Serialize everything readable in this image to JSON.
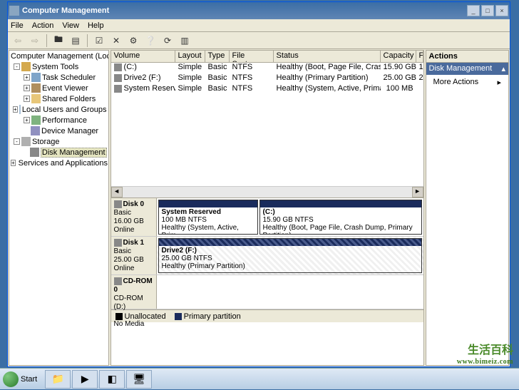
{
  "window": {
    "title": "Computer Management"
  },
  "menu": {
    "file": "File",
    "action": "Action",
    "view": "View",
    "help": "Help"
  },
  "tree": {
    "root": "Computer Management (Local)",
    "system_tools": "System Tools",
    "task_scheduler": "Task Scheduler",
    "event_viewer": "Event Viewer",
    "shared_folders": "Shared Folders",
    "local_users": "Local Users and Groups",
    "performance": "Performance",
    "device_manager": "Device Manager",
    "storage": "Storage",
    "disk_management": "Disk Management",
    "services": "Services and Applications"
  },
  "vol_headers": {
    "volume": "Volume",
    "layout": "Layout",
    "type": "Type",
    "fs": "File System",
    "status": "Status",
    "capacity": "Capacity",
    "f": "F"
  },
  "volumes": [
    {
      "name": "(C:)",
      "layout": "Simple",
      "type": "Basic",
      "fs": "NTFS",
      "status": "Healthy (Boot, Page File, Crash Dump, Primary Partition)",
      "capacity": "15.90 GB"
    },
    {
      "name": "Drive2 (F:)",
      "layout": "Simple",
      "type": "Basic",
      "fs": "NTFS",
      "status": "Healthy (Primary Partition)",
      "capacity": "25.00 GB"
    },
    {
      "name": "System Reserved",
      "layout": "Simple",
      "type": "Basic",
      "fs": "NTFS",
      "status": "Healthy (System, Active, Primary Partition)",
      "capacity": "100 MB"
    }
  ],
  "disks": [
    {
      "label": "Disk 0",
      "type": "Basic",
      "size": "16.00 GB",
      "status": "Online",
      "parts": [
        {
          "name": "System Reserved",
          "sub": "100 MB NTFS",
          "health": "Healthy (System, Active, Prim"
        },
        {
          "name": "(C:)",
          "sub": "15.90 GB NTFS",
          "health": "Healthy (Boot, Page File, Crash Dump, Primary Partition)"
        }
      ]
    },
    {
      "label": "Disk 1",
      "type": "Basic",
      "size": "25.00 GB",
      "status": "Online",
      "parts": [
        {
          "name": "Drive2  (F:)",
          "sub": "25.00 GB NTFS",
          "health": "Healthy (Primary Partition)"
        }
      ]
    },
    {
      "label": "CD-ROM 0",
      "type": "CD-ROM (D:)",
      "size": "",
      "status": "No Media",
      "parts": []
    }
  ],
  "legend": {
    "unalloc": "Unallocated",
    "primary": "Primary partition"
  },
  "actions": {
    "header": "Actions",
    "selected": "Disk Management",
    "more": "More Actions"
  },
  "taskbar": {
    "start": "Start"
  },
  "watermark": {
    "line1": "生活百科",
    "url": "www.bimeiz.com"
  }
}
